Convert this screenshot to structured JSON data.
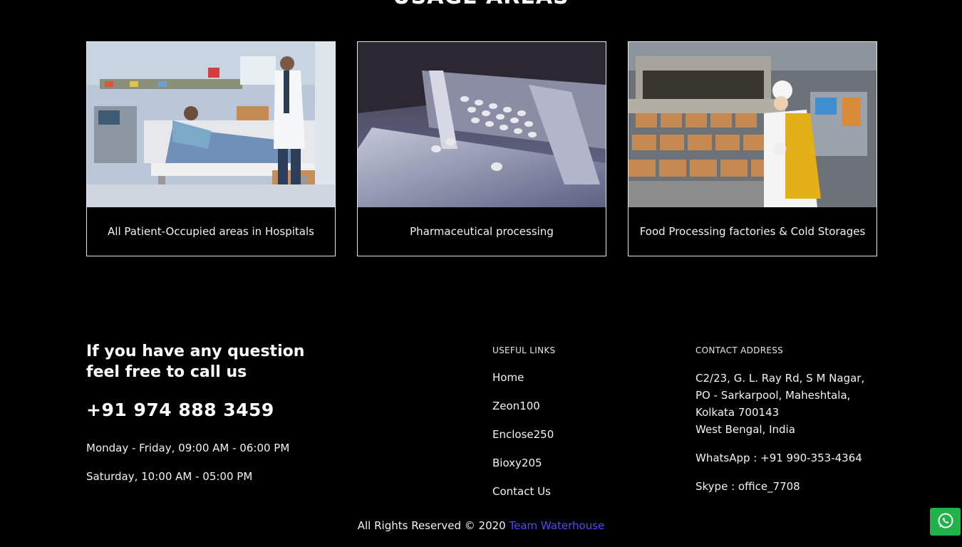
{
  "usage": {
    "heading": "USAGE AREAS",
    "cards": [
      {
        "caption": "All Patient-Occupied areas in Hospitals"
      },
      {
        "caption": "Pharmaceutical processing"
      },
      {
        "caption": "Food Processing factories & Cold Storages"
      }
    ]
  },
  "contact_call": {
    "heading_line1": "If you have any question",
    "heading_line2": "feel free to call us",
    "phone": "+91 974 888 3459",
    "hours_weekday": "Monday - Friday, 09:00 AM - 06:00 PM",
    "hours_saturday": "Saturday, 10:00 AM - 05:00 PM"
  },
  "useful_links": {
    "title": "USEFUL LINKS",
    "items": [
      "Home",
      "Zeon100",
      "Enclose250",
      "Bioxy205",
      "Contact Us"
    ]
  },
  "contact_address": {
    "title": "CONTACT ADDRESS",
    "line1": "C2/23, G. L. Ray Rd, S M Nagar,",
    "line2": "PO - Sarkarpool, Maheshtala,",
    "line3": "Kolkata 700143",
    "line4": "West Bengal, India",
    "whatsapp": "WhatsApp : +91 990-353-4364",
    "skype": "Skype : office_7708"
  },
  "footer": {
    "copyright": "All Rights Reserved © 2020",
    "team_link": "Team Waterhouse"
  },
  "colors": {
    "background": "#000000",
    "link_accent": "#4c4cff",
    "whatsapp_green": "#21b24a"
  },
  "icons": {
    "whatsapp": "whatsapp-icon"
  }
}
